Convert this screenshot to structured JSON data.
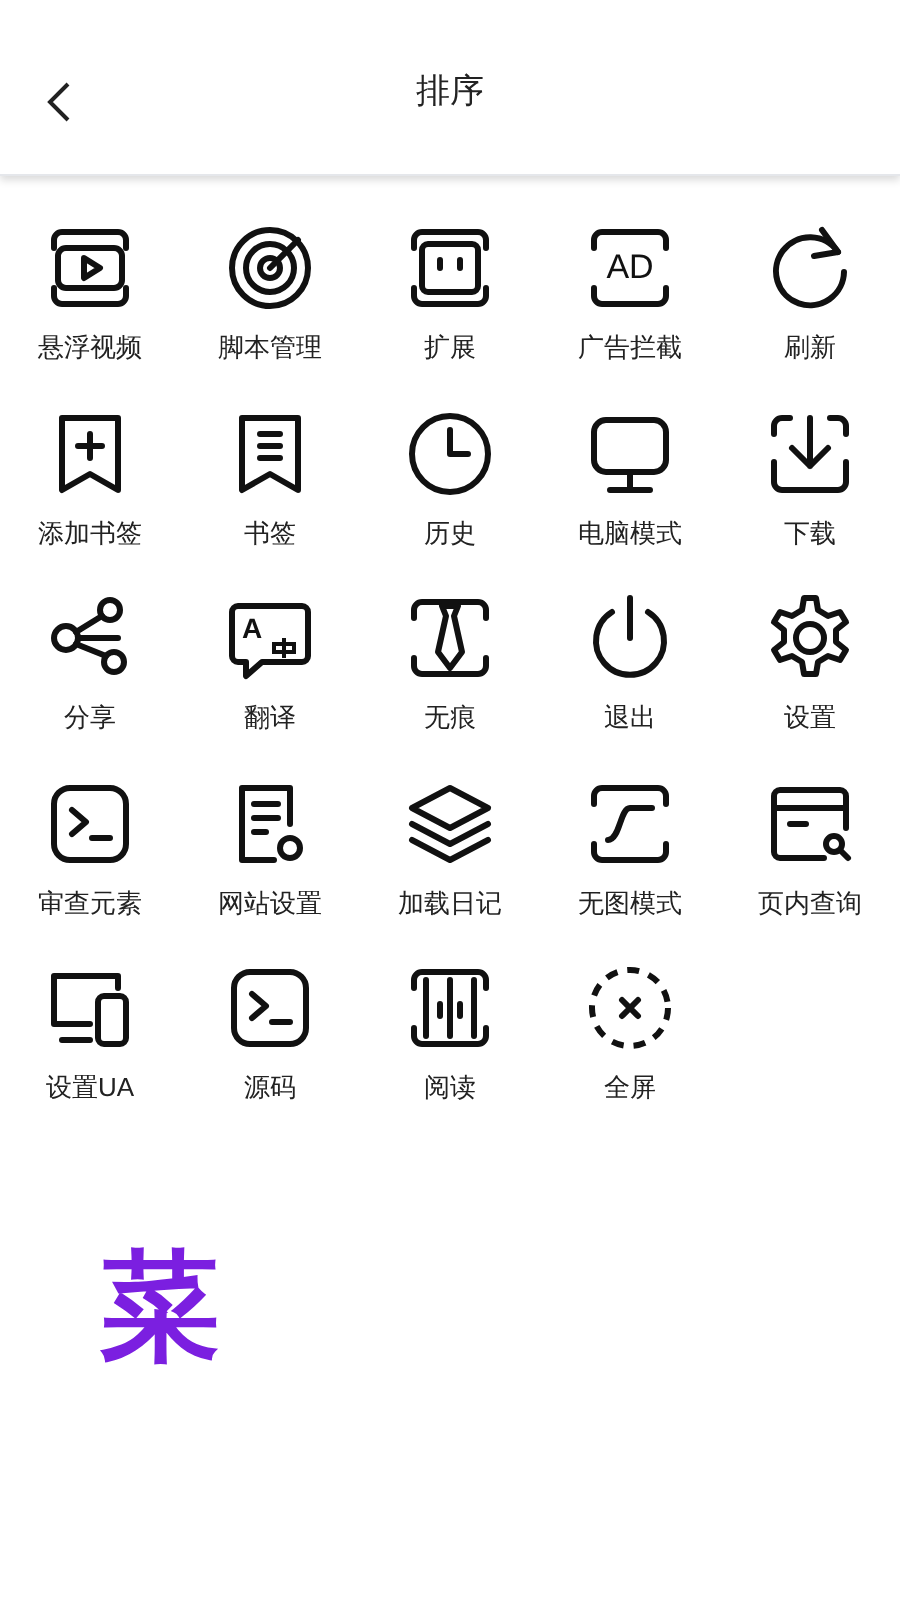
{
  "header": {
    "title": "排序"
  },
  "items": [
    {
      "label": "悬浮视频"
    },
    {
      "label": "脚本管理"
    },
    {
      "label": "扩展"
    },
    {
      "label": "广告拦截",
      "icon_text": "AD"
    },
    {
      "label": "刷新"
    },
    {
      "label": "添加书签"
    },
    {
      "label": "书签"
    },
    {
      "label": "历史"
    },
    {
      "label": "电脑模式"
    },
    {
      "label": "下载"
    },
    {
      "label": "分享"
    },
    {
      "label": "翻译",
      "icon_text": "A"
    },
    {
      "label": "无痕"
    },
    {
      "label": "退出"
    },
    {
      "label": "设置"
    },
    {
      "label": "审查元素"
    },
    {
      "label": "网站设置"
    },
    {
      "label": "加载日记"
    },
    {
      "label": "无图模式"
    },
    {
      "label": "页内查询"
    },
    {
      "label": "设置UA"
    },
    {
      "label": "源码"
    },
    {
      "label": "阅读"
    },
    {
      "label": "全屏"
    }
  ],
  "footer_text": "菜"
}
